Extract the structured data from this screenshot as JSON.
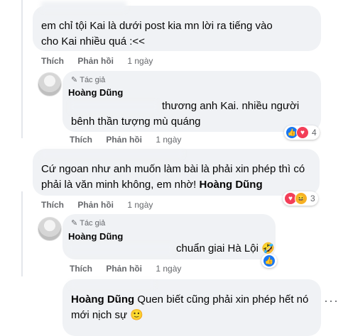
{
  "comments": [
    {
      "text": "em chỉ tội Kai là dưới post kia mn lời ra tiếng vào cho Kai nhiều quá :<<",
      "actions": {
        "like": "Thích",
        "reply": "Phản hồi",
        "time": "1 ngày"
      }
    },
    {
      "author_badge": "Tác giả",
      "name": "Hoàng Dũng",
      "text": "thương anh Kai. nhiều người bênh thần tượng mù quáng",
      "actions": {
        "like": "Thích",
        "reply": "Phản hồi",
        "time": "1 ngày"
      },
      "reaction_count": "4",
      "reactions": [
        "like-icon",
        "love-icon"
      ]
    },
    {
      "text_plain": "Cứ ngoan như anh muốn làm bài là phải xin phép thì có phải là văn minh không, em nhờ!",
      "mention": "Hoàng Dũng",
      "actions": {
        "like": "Thích",
        "reply": "Phản hồi",
        "time": "1 ngày"
      },
      "reaction_count": "3",
      "reactions": [
        "love-icon",
        "haha-icon"
      ]
    },
    {
      "author_badge": "Tác giả",
      "name": "Hoàng Dũng",
      "text": "chuẩn giai Hà Lội",
      "emoji": "🤣",
      "actions": {
        "like": "Thích",
        "reply": "Phản hồi",
        "time": "1 ngày"
      },
      "reactions": [
        "like-icon"
      ]
    },
    {
      "mention": "Hoàng Dũng",
      "text": "Quen biết cũng phải xin phép hết nó mới nịch sự",
      "emoji": "🙂"
    }
  ],
  "more_options": "···"
}
